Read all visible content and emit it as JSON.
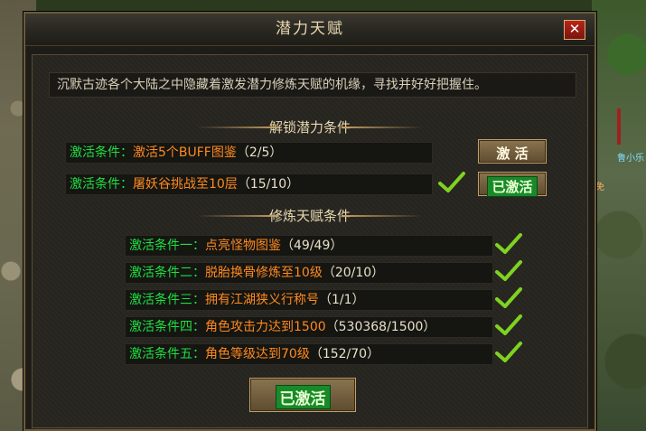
{
  "window": {
    "title": "潜力天赋",
    "close_label": "✕"
  },
  "description": "沉默古迹各个大陆之中隐藏着激发潜力修炼天赋的机缘，寻找并好好把握住。",
  "unlock_section": {
    "header": "解锁潜力条件",
    "conditions": [
      {
        "label": "激活条件：",
        "value": "激活5个BUFF图鉴",
        "progress": "（2/5）",
        "completed": false,
        "button": "激 活"
      },
      {
        "label": "激活条件：",
        "value": "屠妖谷挑战至10层",
        "progress": "（15/10）",
        "completed": true,
        "button": "已激活"
      }
    ]
  },
  "train_section": {
    "header": "修炼天赋条件",
    "conditions": [
      {
        "label": "激活条件一：",
        "value": "点亮怪物图鉴",
        "progress": "（49/49）",
        "completed": true
      },
      {
        "label": "激活条件二：",
        "value": "脱胎换骨修炼至10级",
        "progress": "（20/10）",
        "completed": true
      },
      {
        "label": "激活条件三：",
        "value": "拥有江湖狭义行称号",
        "progress": "（1/1）",
        "completed": true
      },
      {
        "label": "激活条件四：",
        "value": "角色攻击力达到1500",
        "progress": "（530368/1500）",
        "completed": true
      },
      {
        "label": "激活条件五：",
        "value": "角色等级达到70级",
        "progress": "（152/70）",
        "completed": true
      }
    ],
    "button": "已激活"
  },
  "background": {
    "npc_label": "鲁小乐",
    "npc_label2": "免"
  },
  "colors": {
    "condition_label": "#1ee040",
    "condition_value": "#ff8a1e",
    "check": "#7ed321",
    "activated_bg": "#188a2a"
  }
}
